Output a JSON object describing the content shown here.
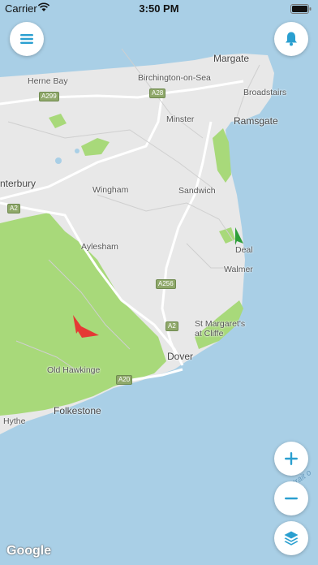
{
  "status_bar": {
    "carrier": "Carrier",
    "time": "3:50 PM"
  },
  "icons": {
    "menu": "hamburger-icon",
    "notifications": "bell-icon",
    "zoom_in": "plus-icon",
    "zoom_out": "minus-icon",
    "layers": "layers-icon",
    "wifi": "wifi-icon",
    "battery": "battery-icon"
  },
  "colors": {
    "accent": "#2a9fd0",
    "sea": "#a9cfe6",
    "land": "#e8e8e8",
    "woodland": "#a8d97a",
    "marker_red": "#e53935",
    "marker_green": "#2e9e3a"
  },
  "map": {
    "places": {
      "margate": "Margate",
      "herne_bay": "Herne Bay",
      "birchington": "Birchington-on-Sea",
      "broadstairs": "Broadstairs",
      "minster": "Minster",
      "ramsgate": "Ramsgate",
      "canterbury": "nterbury",
      "wingham": "Wingham",
      "sandwich": "Sandwich",
      "deal": "Deal",
      "aylesham": "Aylesham",
      "walmer": "Walmer",
      "st_margarets": "St Margaret's\nat Cliffe",
      "dover": "Dover",
      "old_hawkinge": "Old Hawkinge",
      "hythe": "Hythe",
      "folkestone": "Folkestone",
      "strait": "Strait o"
    },
    "roads": {
      "a299": "A299",
      "a28": "A28",
      "a2_west": "A2",
      "a256": "A256",
      "a2_dover": "A2",
      "a20": "A20"
    },
    "attribution": "Google"
  }
}
